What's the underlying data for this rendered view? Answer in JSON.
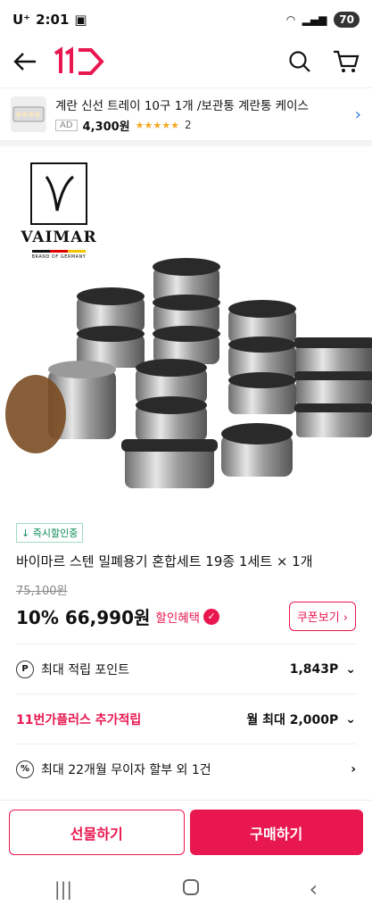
{
  "status": {
    "carrier": "U⁺",
    "time": "2:01",
    "battery": "70"
  },
  "ad": {
    "title": "계란 신선 트레이 10구 1개 /보관통 계란통 케이스",
    "badge": "AD",
    "price": "4,300원",
    "stars": "★★★★★",
    "count": "2"
  },
  "brand": {
    "name": "VAIMAR",
    "sub": "BRAND OF GERMANY"
  },
  "product": {
    "tag": "↓ 즉시할인중",
    "title": "바이마르 스텐 밀폐용기 혼합세트 19종 1세트 × 1개",
    "original_price": "75,100원",
    "price": "10% 66,990원",
    "discount_label": "할인혜택",
    "coupon_label": "쿠폰보기"
  },
  "rows": [
    {
      "icon": "P",
      "label": "최대 적립 포인트",
      "value": "1,843P"
    },
    {
      "label": "11번가플러스 추가적립",
      "value": "월 최대 2,000P"
    },
    {
      "icon": "%",
      "label": "최대 22개월 무이자 할부 외 1건",
      "value": ""
    }
  ],
  "footer": {
    "gift": "선물하기",
    "buy": "구매하기"
  }
}
